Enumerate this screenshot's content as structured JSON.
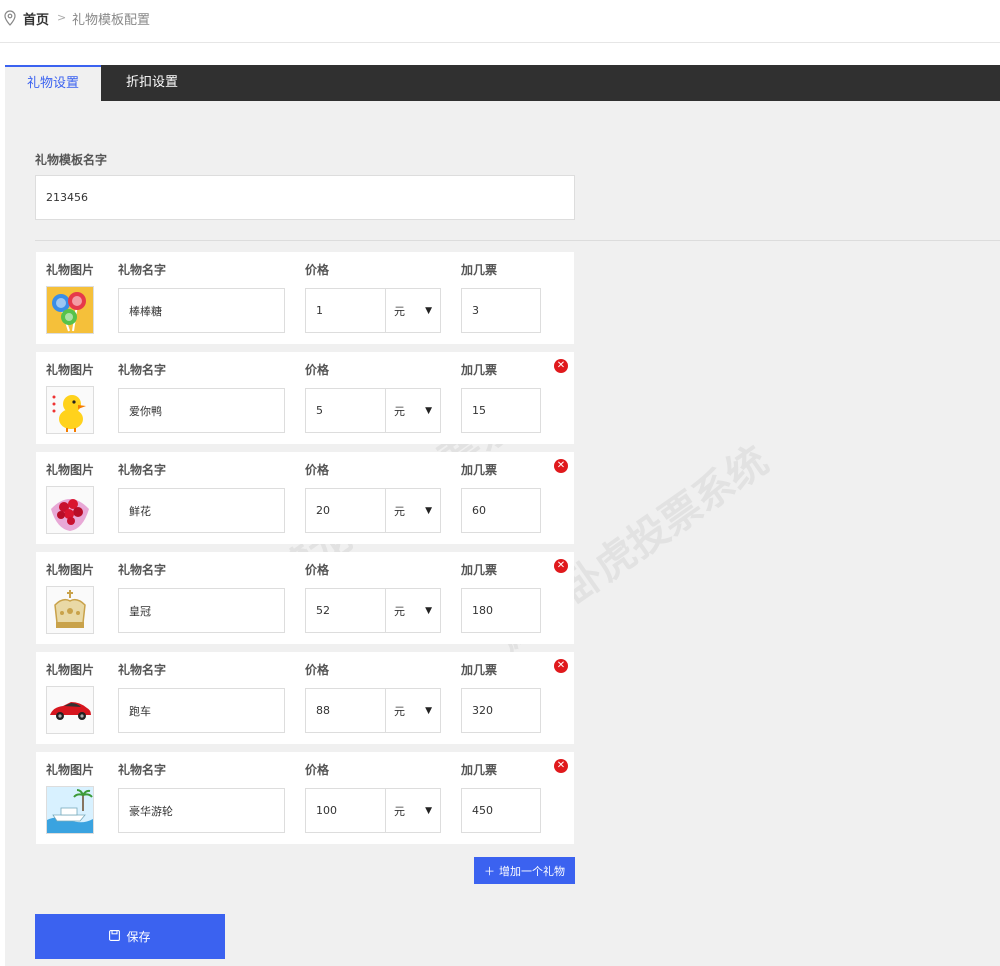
{
  "breadcrumb": {
    "home": "首页",
    "separator": ">",
    "current": "礼物模板配置"
  },
  "tabs": [
    {
      "label": "礼物设置",
      "active": true
    },
    {
      "label": "折扣设置",
      "active": false
    }
  ],
  "template": {
    "label": "礼物模板名字",
    "value": "213456"
  },
  "labels": {
    "image": "礼物图片",
    "name": "礼物名字",
    "price": "价格",
    "votes": "加几票"
  },
  "gifts": [
    {
      "name": "棒棒糖",
      "price": "1",
      "unit": "元",
      "votes": "3",
      "icon": "lollipop-icon",
      "deletable": false
    },
    {
      "name": "爱你鸭",
      "price": "5",
      "unit": "元",
      "votes": "15",
      "icon": "duck-icon",
      "deletable": true
    },
    {
      "name": "鲜花",
      "price": "20",
      "unit": "元",
      "votes": "60",
      "icon": "flower-bouquet-icon",
      "deletable": true
    },
    {
      "name": "皇冠",
      "price": "52",
      "unit": "元",
      "votes": "180",
      "icon": "crown-icon",
      "deletable": true
    },
    {
      "name": "跑车",
      "price": "88",
      "unit": "元",
      "votes": "320",
      "icon": "sports-car-icon",
      "deletable": true
    },
    {
      "name": "豪华游轮",
      "price": "100",
      "unit": "元",
      "votes": "450",
      "icon": "cruise-ship-icon",
      "deletable": true
    }
  ],
  "buttons": {
    "add": "增加一个礼物",
    "save": "保存"
  },
  "watermark": "藏龙卧虎投票系统",
  "colors": {
    "accent": "#3b62f0",
    "tabbar": "#303030",
    "panel": "#f0f0f0",
    "delete": "#e0191c"
  }
}
